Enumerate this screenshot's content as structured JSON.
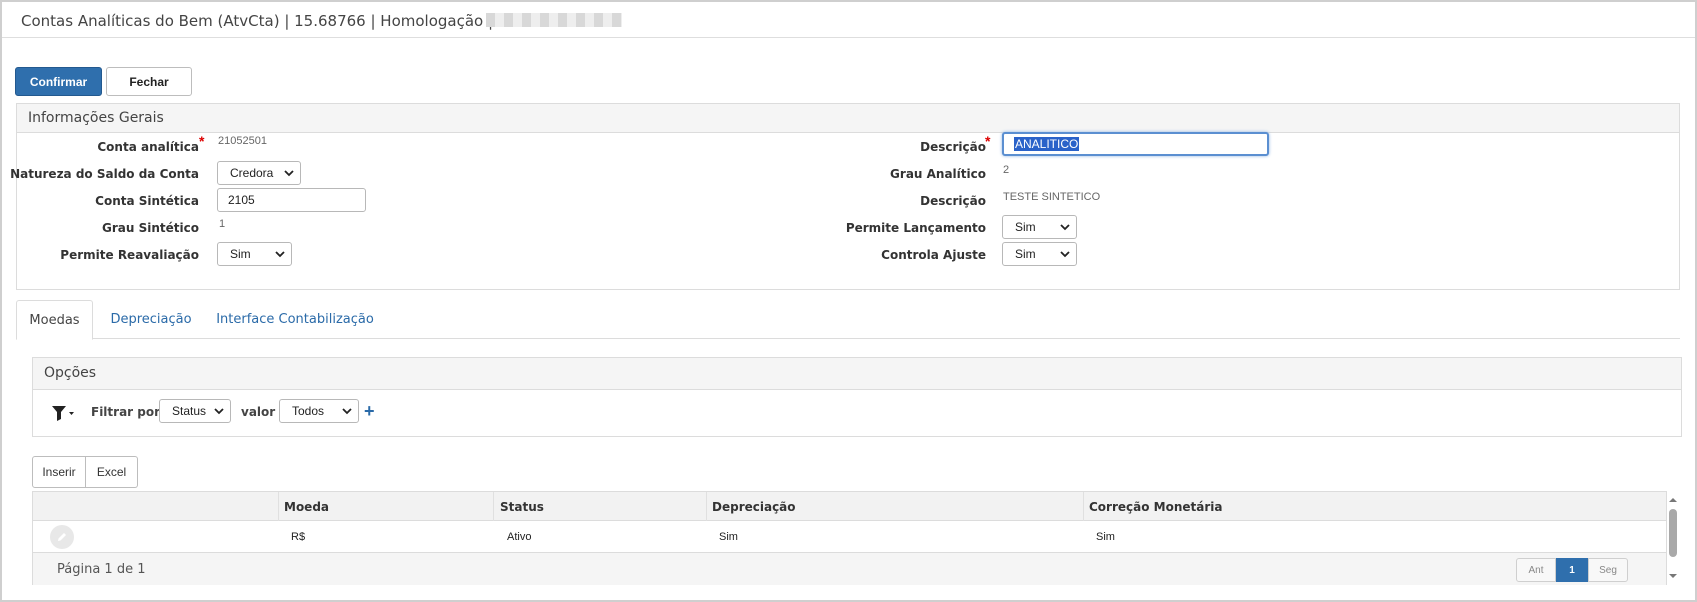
{
  "window": {
    "title": "Contas Analíticas do Bem (AtvCta) | 15.68766 | Homologação | S"
  },
  "toolbar": {
    "confirm_label": "Confirmar",
    "close_label": "Fechar"
  },
  "general": {
    "heading": "Informações Gerais",
    "conta_analitica_label": "Conta analítica",
    "conta_analitica_value": "21052501",
    "natureza_label": "Natureza do Saldo da Conta",
    "natureza_value": "Credora",
    "conta_sintetica_label": "Conta Sintética",
    "conta_sintetica_value": "2105",
    "grau_sintetico_label": "Grau Sintético",
    "grau_sintetico_value": "1",
    "permite_reavaliacao_label": "Permite Reavaliação",
    "permite_reavaliacao_value": "Sim",
    "descricao_label": "Descrição",
    "descricao_value": "ANALITICO",
    "grau_analitico_label": "Grau Analítico",
    "grau_analitico_value": "2",
    "descricao2_label": "Descrição",
    "descricao2_value": "TESTE SINTETICO",
    "permite_lancamento_label": "Permite Lançamento",
    "permite_lancamento_value": "Sim",
    "controla_ajuste_label": "Controla Ajuste",
    "controla_ajuste_value": "Sim",
    "required_mark": "*"
  },
  "tabs": [
    {
      "label": "Moedas",
      "active": true
    },
    {
      "label": "Depreciação",
      "active": false
    },
    {
      "label": "Interface Contabilização",
      "active": false
    }
  ],
  "options": {
    "heading": "Opções",
    "filter_by_label": "Filtrar por",
    "filter_field_value": "Status",
    "value_label": "valor",
    "filter_value": "Todos",
    "add_symbol": "+"
  },
  "grid": {
    "insert_label": "Inserir",
    "excel_label": "Excel",
    "columns": [
      "Moeda",
      "Status",
      "Depreciação",
      "Correção Monetária"
    ],
    "rows": [
      {
        "moeda": "R$",
        "status": "Ativo",
        "depreciacao": "Sim",
        "correcao": "Sim"
      }
    ],
    "page_info": "Página 1 de 1",
    "prev_label": "Ant",
    "current_page": "1",
    "next_label": "Seg"
  },
  "icons": {
    "filter": "funnel-icon",
    "edit": "pencil-icon",
    "caret": "chevron-down-icon"
  },
  "colors": {
    "primary": "#2f6fad",
    "link": "#2a6aa8",
    "required": "#dd0000"
  }
}
